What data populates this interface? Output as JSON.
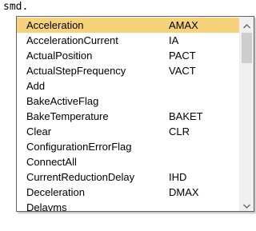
{
  "editor": {
    "line_text": "smd."
  },
  "autocomplete": {
    "items": [
      {
        "name": "Acceleration",
        "abbr": "AMAX",
        "selected": true
      },
      {
        "name": "AccelerationCurrent",
        "abbr": "IA"
      },
      {
        "name": "ActualPosition",
        "abbr": "PACT"
      },
      {
        "name": "ActualStepFrequency",
        "abbr": "VACT"
      },
      {
        "name": "Add",
        "abbr": ""
      },
      {
        "name": "BakeActiveFlag",
        "abbr": ""
      },
      {
        "name": "BakeTemperature",
        "abbr": "BAKET"
      },
      {
        "name": "Clear",
        "abbr": "CLR"
      },
      {
        "name": "ConfigurationErrorFlag",
        "abbr": ""
      },
      {
        "name": "ConnectAll",
        "abbr": ""
      },
      {
        "name": "CurrentReductionDelay",
        "abbr": "IHD"
      },
      {
        "name": "Deceleration",
        "abbr": "DMAX"
      },
      {
        "name": "Delayms",
        "abbr": ""
      }
    ],
    "scroll_position": 0.0,
    "colors": {
      "selection": "#f6d37a",
      "border": "#646464",
      "scroll_track": "#f0f0f0",
      "scroll_thumb": "#cdcdcd"
    },
    "icons": {
      "scroll_up": "chevron-up-icon",
      "scroll_down": "chevron-down-icon"
    }
  }
}
